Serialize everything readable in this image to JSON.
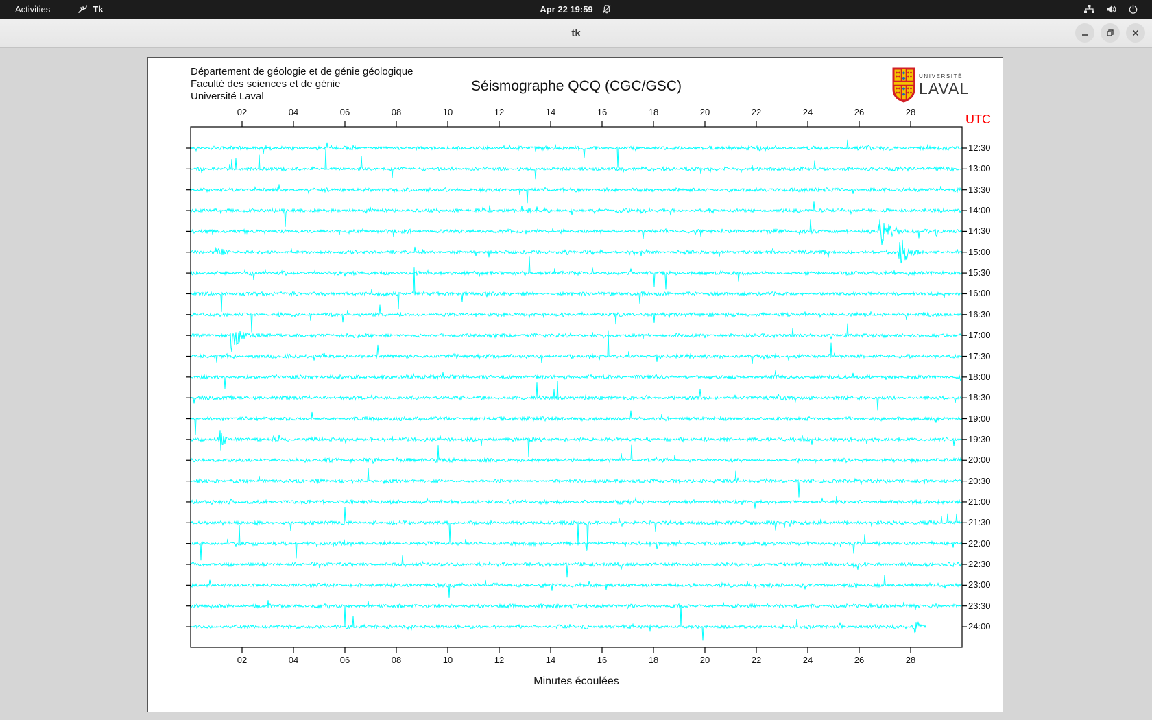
{
  "top_bar": {
    "activities": "Activities",
    "app_name": "Tk",
    "clock": "Apr 22 19:59"
  },
  "titlebar": {
    "title": "tk",
    "minimize_label": "minimize",
    "restore_label": "restore",
    "close_label": "close"
  },
  "canvas": {
    "header_line1": "Département de géologie et de génie géologique",
    "header_line2": "Faculté des sciences et de génie",
    "header_line3": "Université Laval",
    "title": "Séismographe QCQ (CGC/GSC)",
    "utc_label": "UTC",
    "xlabel": "Minutes écoulées",
    "logo_small": "UNIVERSITÉ",
    "logo_large": "LAVAL"
  },
  "colors": {
    "trace": "#00FFFF",
    "utc_label": "#FF0000",
    "plot_frame": "#000000",
    "logo_red": "#d21f26",
    "logo_gold": "#f5c400",
    "logo_blue": "#1b6fb5"
  },
  "chart_data": {
    "type": "line",
    "title": "Séismographe QCQ (CGC/GSC)",
    "xlabel": "Minutes écoulées",
    "right_axis_label": "UTC",
    "x_axis": {
      "min": 0,
      "max": 30,
      "tick_labels": [
        "02",
        "04",
        "06",
        "08",
        "10",
        "12",
        "14",
        "16",
        "18",
        "20",
        "22",
        "24",
        "26",
        "28"
      ]
    },
    "trace_color": "#00FFFF",
    "rows": [
      {
        "utc": "12:30"
      },
      {
        "utc": "13:00"
      },
      {
        "utc": "13:30"
      },
      {
        "utc": "14:00"
      },
      {
        "utc": "14:30",
        "events": [
          {
            "min": 26.8,
            "amp": 26,
            "w": 1.0
          }
        ]
      },
      {
        "utc": "15:00",
        "events": [
          {
            "min": 1.0,
            "amp": 9,
            "w": 0.8
          },
          {
            "min": 27.6,
            "amp": 22,
            "w": 0.9
          }
        ]
      },
      {
        "utc": "15:30"
      },
      {
        "utc": "16:00"
      },
      {
        "utc": "16:30"
      },
      {
        "utc": "17:00",
        "events": [
          {
            "min": 1.6,
            "amp": 24,
            "w": 0.8
          }
        ]
      },
      {
        "utc": "17:30"
      },
      {
        "utc": "18:00"
      },
      {
        "utc": "18:30"
      },
      {
        "utc": "19:00"
      },
      {
        "utc": "19:30",
        "events": [
          {
            "min": 1.2,
            "amp": 20,
            "w": 0.3
          }
        ]
      },
      {
        "utc": "20:00"
      },
      {
        "utc": "20:30"
      },
      {
        "utc": "21:00"
      },
      {
        "utc": "21:30"
      },
      {
        "utc": "22:00"
      },
      {
        "utc": "22:30"
      },
      {
        "utc": "23:00"
      },
      {
        "utc": "23:30"
      },
      {
        "utc": "24:00",
        "end_min": 28.6,
        "events": [
          {
            "min": 28.2,
            "amp": 11,
            "w": 0.5
          }
        ]
      }
    ]
  }
}
